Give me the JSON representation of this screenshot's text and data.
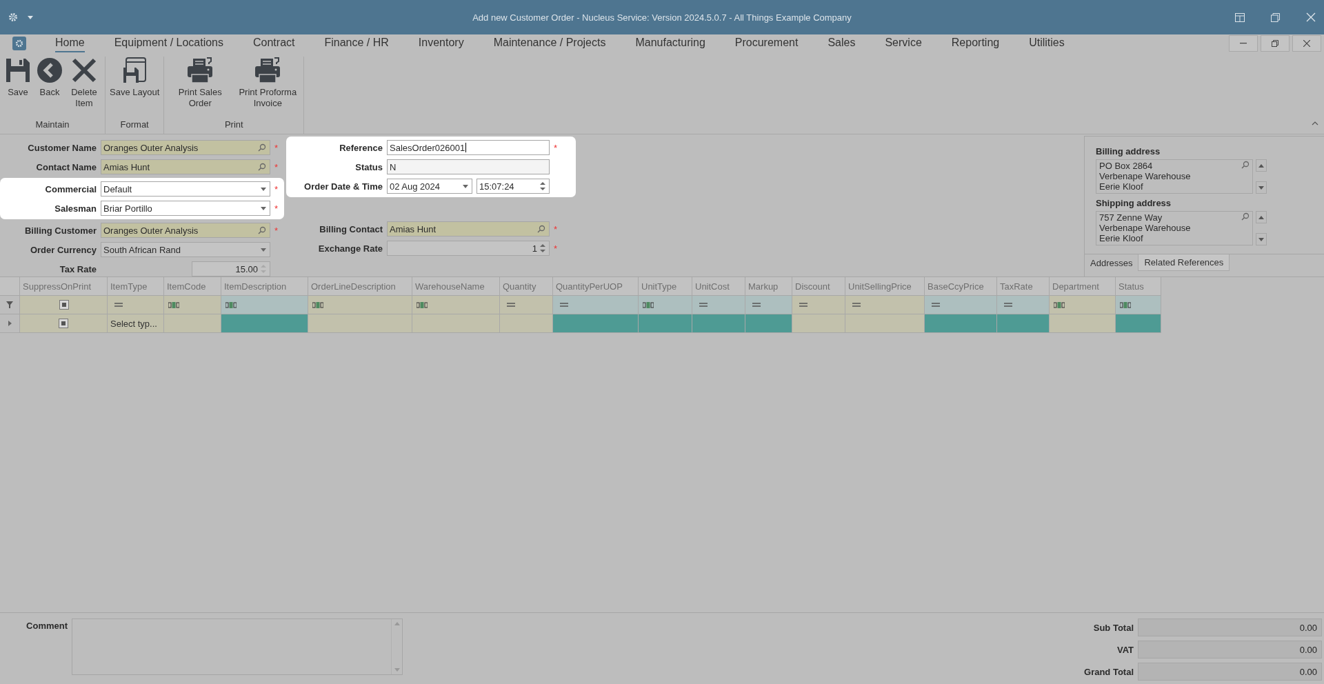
{
  "window": {
    "title": "Add new Customer Order - Nucleus Service: Version 2024.5.0.7 - All Things Example Company"
  },
  "ribbon": {
    "tabs": [
      {
        "label": "Home",
        "selected": true
      },
      {
        "label": "Equipment / Locations",
        "selected": false
      },
      {
        "label": "Contract",
        "selected": false
      },
      {
        "label": "Finance / HR",
        "selected": false
      },
      {
        "label": "Inventory",
        "selected": false
      },
      {
        "label": "Maintenance / Projects",
        "selected": false
      },
      {
        "label": "Manufacturing",
        "selected": false
      },
      {
        "label": "Procurement",
        "selected": false
      },
      {
        "label": "Sales",
        "selected": false
      },
      {
        "label": "Service",
        "selected": false
      },
      {
        "label": "Reporting",
        "selected": false
      },
      {
        "label": "Utilities",
        "selected": false
      }
    ],
    "groups": [
      {
        "label": "Maintain",
        "buttons": [
          {
            "label": "Save",
            "kind": "save"
          },
          {
            "label": "Back",
            "kind": "back"
          },
          {
            "label": "Delete Item",
            "kind": "delete"
          }
        ]
      },
      {
        "label": "Format",
        "buttons": [
          {
            "label": "Save Layout",
            "kind": "layout"
          }
        ]
      },
      {
        "label": "Print",
        "buttons": [
          {
            "label": "Print Sales Order",
            "kind": "print"
          },
          {
            "label": "Print Proforma Invoice",
            "kind": "print"
          }
        ]
      }
    ]
  },
  "form": {
    "required_mark": "*",
    "columns": [
      {
        "groups": [
          {
            "highlighted": false,
            "fields": [
              {
                "label": "Customer Name",
                "kind": "lookup",
                "value": "Oranges Outer Analysis",
                "required": true
              },
              {
                "label": "Contact Name",
                "kind": "lookup",
                "value": "Amias Hunt",
                "required": true
              }
            ]
          },
          {
            "highlighted": true,
            "fields": [
              {
                "label": "Commercial",
                "kind": "combo",
                "value": "Default",
                "required": true
              },
              {
                "label": "Salesman",
                "kind": "combo",
                "value": "Briar Portillo",
                "required": true
              }
            ]
          },
          {
            "highlighted": false,
            "fields": [
              {
                "label": "Billing Customer",
                "kind": "lookup",
                "value": "Oranges Outer Analysis",
                "required": true
              },
              {
                "label": "Order Currency",
                "kind": "combo",
                "value": "South African Rand",
                "required": false
              },
              {
                "label": "Tax Rate",
                "kind": "short-spin",
                "value": "15.00",
                "required": false
              }
            ]
          }
        ]
      },
      {
        "groups": [
          {
            "highlighted": true,
            "fields": [
              {
                "label": "Reference",
                "kind": "text",
                "value": "SalesOrder026001",
                "required": true
              },
              {
                "label": "Status",
                "kind": "readonly",
                "value": "N",
                "required": false
              },
              {
                "label": "Order Date & Time",
                "kind": "datetime",
                "value": "02 Aug 2024",
                "time": "15:07:24",
                "required": false
              }
            ]
          },
          {
            "highlighted": false,
            "fields": [
              {
                "label": "Billing Contact",
                "kind": "lookup",
                "value": "Amias Hunt",
                "required": true
              },
              {
                "label": "Exchange Rate",
                "kind": "spin",
                "value": "1",
                "required": true
              }
            ]
          }
        ]
      }
    ]
  },
  "addresses": {
    "blocks": [
      {
        "label": "Billing address",
        "lines": [
          "PO Box 2864",
          "Verbenape Warehouse",
          "Eerie Kloof"
        ]
      },
      {
        "label": "Shipping address",
        "lines": [
          "757 Zenne Way",
          "Verbenape Warehouse",
          "Eerie Kloof"
        ]
      }
    ],
    "tabs": [
      {
        "label": "Addresses",
        "selected": true
      },
      {
        "label": "Related References",
        "selected": false
      }
    ]
  },
  "grid": {
    "columns": [
      {
        "label": "SuppressOnPrint",
        "kind": "checkbox",
        "checked": false,
        "readonly": false
      },
      {
        "label": "ItemType",
        "kind": "equals",
        "readonly": false
      },
      {
        "label": "ItemCode",
        "kind": "text",
        "readonly": false
      },
      {
        "label": "ItemDescription",
        "kind": "text",
        "readonly": true
      },
      {
        "label": "OrderLineDescription",
        "kind": "text",
        "readonly": false
      },
      {
        "label": "WarehouseName",
        "kind": "text",
        "readonly": false
      },
      {
        "label": "Quantity",
        "kind": "equals",
        "readonly": false
      },
      {
        "label": "QuantityPerUOP",
        "kind": "equals",
        "readonly": true
      },
      {
        "label": "UnitType",
        "kind": "text",
        "readonly": true
      },
      {
        "label": "UnitCost",
        "kind": "equals",
        "readonly": true
      },
      {
        "label": "Markup",
        "kind": "equals",
        "readonly": true
      },
      {
        "label": "Discount",
        "kind": "equals",
        "readonly": false
      },
      {
        "label": "UnitSellingPrice",
        "kind": "equals",
        "readonly": false
      },
      {
        "label": "BaseCcyPrice",
        "kind": "equals",
        "readonly": true
      },
      {
        "label": "TaxRate",
        "kind": "equals",
        "readonly": true
      },
      {
        "label": "Department",
        "kind": "text",
        "readonly": false
      },
      {
        "label": "Status",
        "kind": "text",
        "readonly": true
      }
    ],
    "rows": [
      {
        "cells": [
          {
            "kind": "checkbox",
            "checked": false
          },
          {
            "kind": "text",
            "text": "Select typ..."
          },
          {
            "kind": "blank"
          },
          {
            "kind": "blank"
          },
          {
            "kind": "blank"
          },
          {
            "kind": "blank"
          },
          {
            "kind": "blank"
          },
          {
            "kind": "blank"
          },
          {
            "kind": "blank"
          },
          {
            "kind": "blank"
          },
          {
            "kind": "blank"
          },
          {
            "kind": "blank"
          },
          {
            "kind": "blank"
          },
          {
            "kind": "blank"
          },
          {
            "kind": "blank"
          },
          {
            "kind": "blank"
          },
          {
            "kind": "blank"
          }
        ]
      }
    ]
  },
  "footer": {
    "comment_label": "Comment",
    "totals": [
      {
        "label": "Sub Total",
        "value": "0.00"
      },
      {
        "label": "VAT",
        "value": "0.00"
      },
      {
        "label": "Grand Total",
        "value": "0.00"
      }
    ]
  }
}
